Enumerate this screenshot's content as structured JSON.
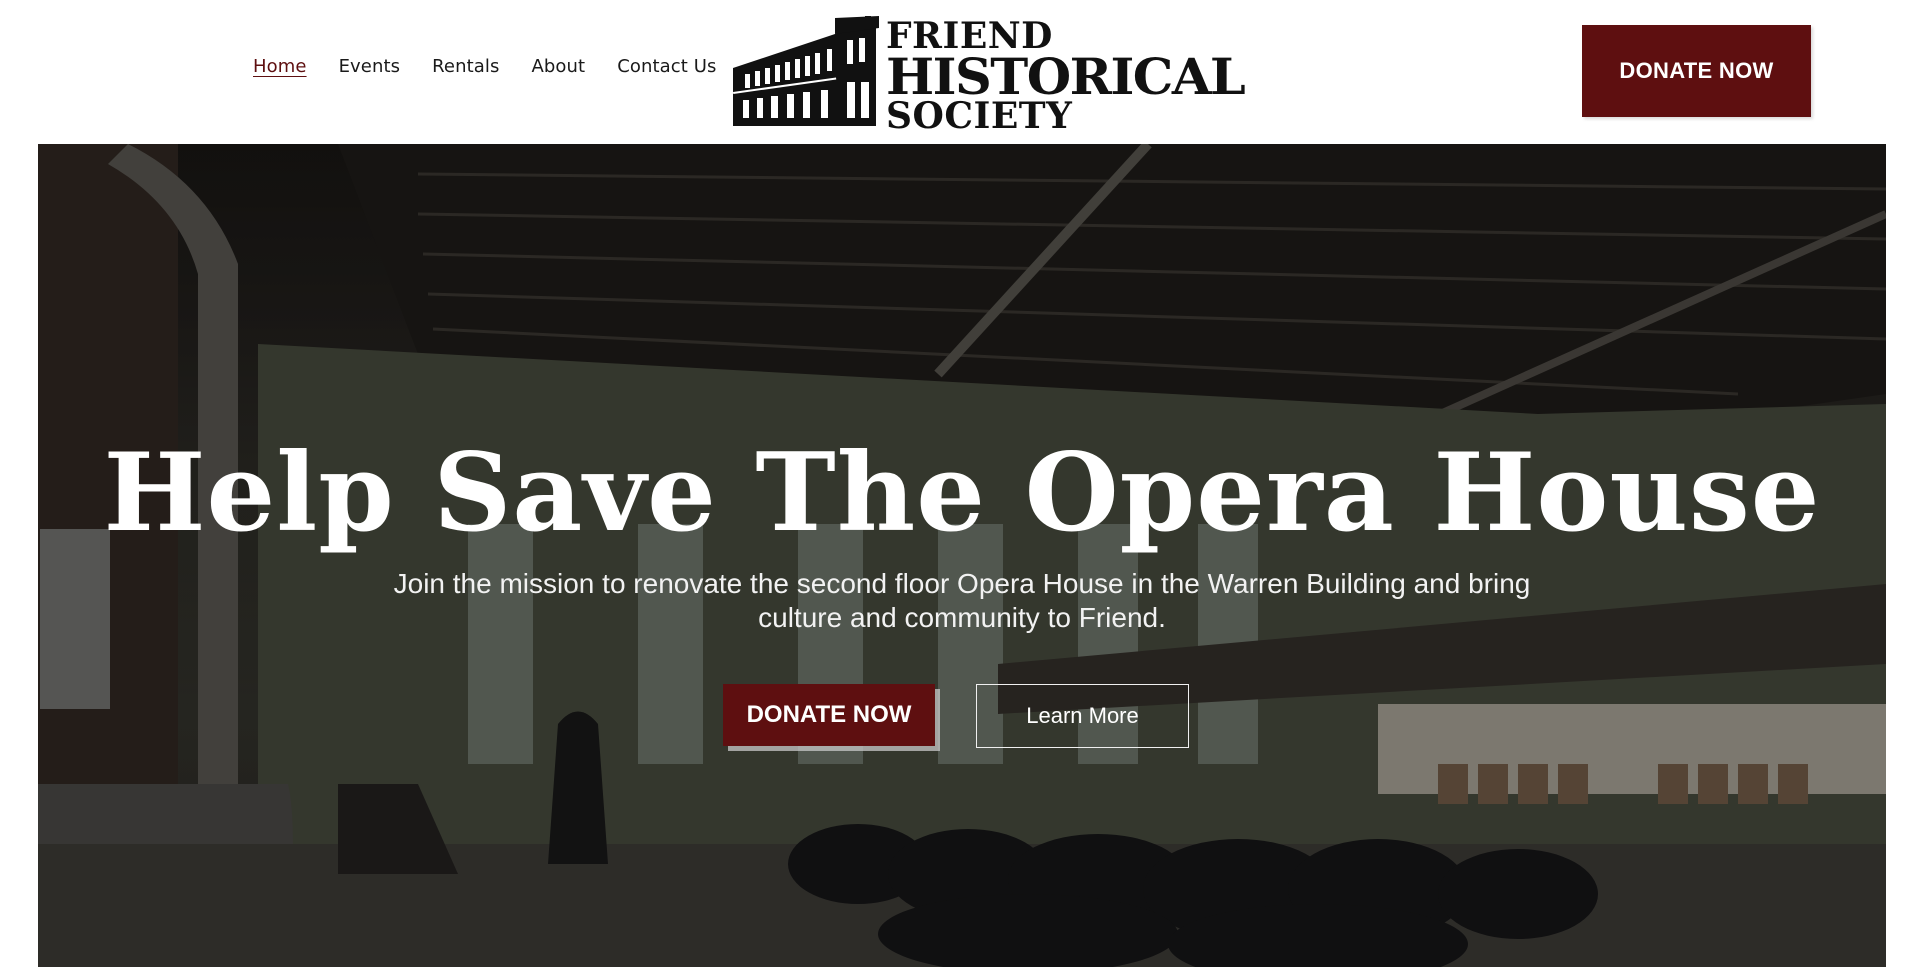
{
  "nav": {
    "items": [
      {
        "label": "Home",
        "active": true
      },
      {
        "label": "Events",
        "active": false
      },
      {
        "label": "Rentals",
        "active": false
      },
      {
        "label": "About",
        "active": false
      },
      {
        "label": "Contact Us",
        "active": false
      }
    ]
  },
  "logo": {
    "line1": "FRIEND",
    "line2": "HISTORICAL",
    "line3": "SOCIETY",
    "icon": "historic-building-icon"
  },
  "header": {
    "donate_label": "DONATE NOW"
  },
  "hero": {
    "title": "Help Save The Opera House",
    "subtitle": "Join the mission to renovate the second floor Opera House in the Warren Building and bring culture and community to Friend.",
    "donate_label": "DONATE NOW",
    "learn_label": "Learn More"
  },
  "colors": {
    "brand": "#5e0f10",
    "text": "#1a1a1a",
    "hero_text": "#ffffff"
  }
}
